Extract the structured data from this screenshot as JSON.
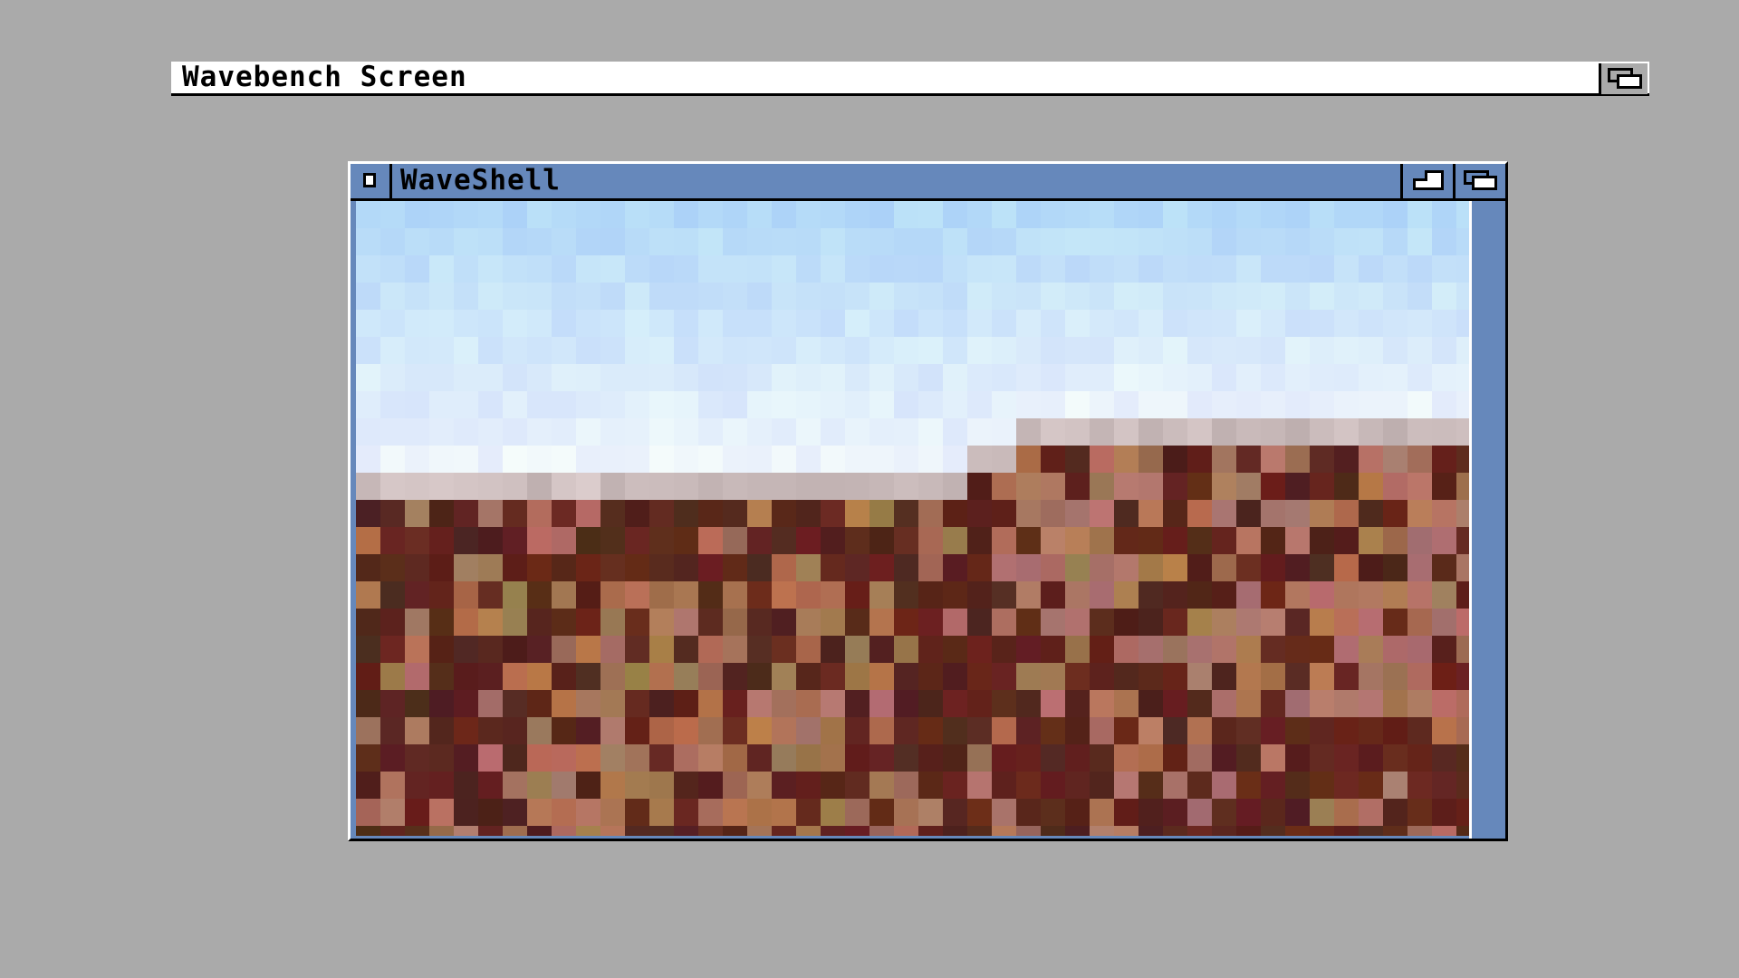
{
  "screen": {
    "title": "Wavebench Screen",
    "depth_icon": "screen-depth-icon"
  },
  "window": {
    "title": "WaveShell",
    "close_icon": "close-icon",
    "zoom_icon": "zoom-icon",
    "depth_icon": "depth-icon",
    "content": "pixelated landscape image: sky and reddish-brown rocky terrain"
  },
  "colors": {
    "background": "#aaaaaa",
    "window_chrome": "#6688bb",
    "screen_bar": "#ffffff",
    "sky": "#c5e0f5",
    "terrain_dark": "#4e2019",
    "terrain_mid": "#7c4a3c",
    "terrain_light": "#a87a62"
  }
}
